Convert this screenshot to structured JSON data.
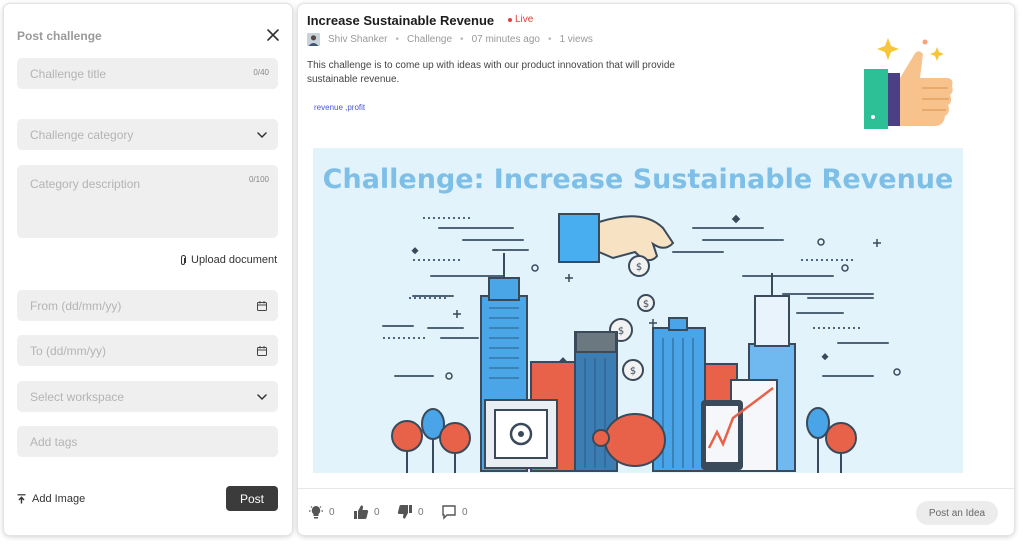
{
  "form": {
    "title": "Post challenge",
    "challenge_title": {
      "placeholder": "Challenge title",
      "counter": "0/40"
    },
    "category": {
      "placeholder": "Challenge category"
    },
    "description": {
      "placeholder": "Category description",
      "counter": "0/100"
    },
    "upload_label": "Upload document",
    "from": {
      "placeholder": "From (dd/mm/yy)"
    },
    "to": {
      "placeholder": "To (dd/mm/yy)"
    },
    "workspace": {
      "placeholder": "Select workspace"
    },
    "tags": {
      "placeholder": "Add tags"
    },
    "add_image_label": "Add Image",
    "post_label": "Post"
  },
  "post": {
    "title": "Increase Sustainable Revenue",
    "status": "Live",
    "author": "Shiv Shanker",
    "type": "Challenge",
    "time": "07 minutes ago",
    "views": "1 views",
    "description": "This challenge is to come up with ideas with our product innovation that will provide sustainable revenue.",
    "tags": "revenue ,profit",
    "banner_title": "Challenge: Increase Sustainable Revenue",
    "thumbnail_icon": "thumbs-up-sparkle-icon"
  },
  "reactions": {
    "idea": "0",
    "likes": "0",
    "dislikes": "0",
    "comments": "0",
    "post_idea_label": "Post an Idea"
  },
  "colors": {
    "live": "#e0403a",
    "tags_link": "#4a56d6",
    "post_button": "#3b3b3b",
    "banner_bg": "#e3f3fb",
    "banner_title": "#7ebfe8"
  }
}
